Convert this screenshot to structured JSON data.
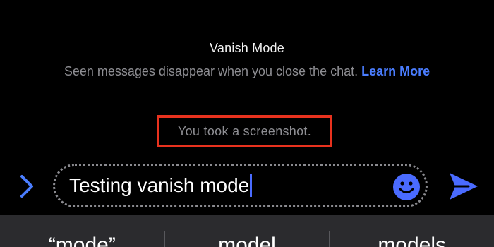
{
  "vanish": {
    "title": "Vanish Mode",
    "description": "Seen messages disappear when you close the chat.",
    "learn_more": "Learn More"
  },
  "notice": {
    "screenshot_text": "You took a screenshot."
  },
  "composer": {
    "text": "Testing vanish mode",
    "expand_icon": "chevron-right-icon",
    "emoji_icon": "smiley-icon",
    "send_icon": "paper-plane-icon"
  },
  "keyboard": {
    "suggestions": [
      "“mode”",
      "model",
      "models"
    ]
  },
  "colors": {
    "accent": "#4a7dff",
    "highlight_border": "#e8321e",
    "muted_text": "#8e8e93",
    "keyboard_bg": "#2b2b2e"
  }
}
